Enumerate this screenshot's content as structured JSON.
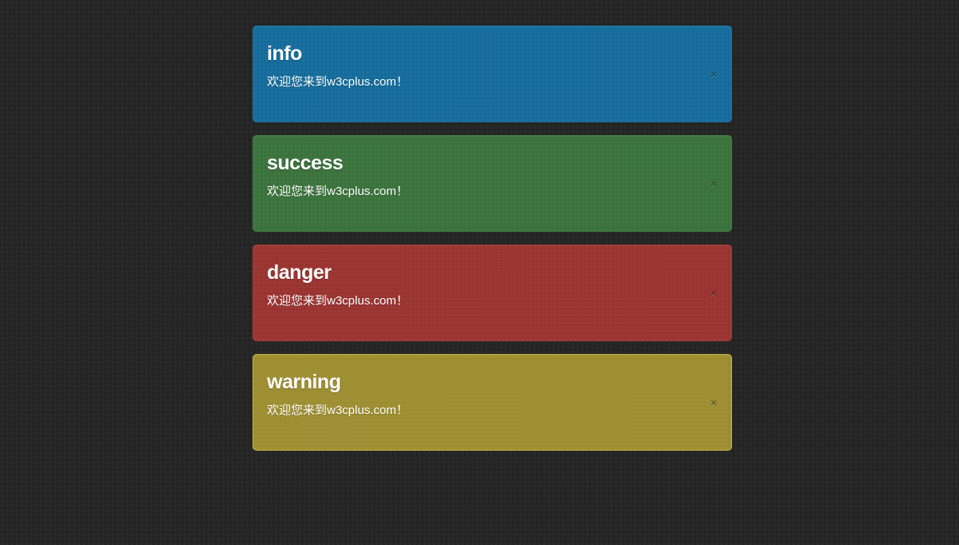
{
  "alerts": [
    {
      "variant": "info",
      "title": "info",
      "message": "欢迎您来到w3cplus.com！",
      "close_icon": "×",
      "color": "#156c9b"
    },
    {
      "variant": "success",
      "title": "success",
      "message": "欢迎您来到w3cplus.com！",
      "close_icon": "×",
      "color": "#3b733c"
    },
    {
      "variant": "danger",
      "title": "danger",
      "message": "欢迎您来到w3cplus.com！",
      "close_icon": "×",
      "color": "#9a3431"
    },
    {
      "variant": "warning",
      "title": "warning",
      "message": "欢迎您来到w3cplus.com！",
      "close_icon": "×",
      "color": "#9e8e32"
    }
  ],
  "background_color": "#262626"
}
